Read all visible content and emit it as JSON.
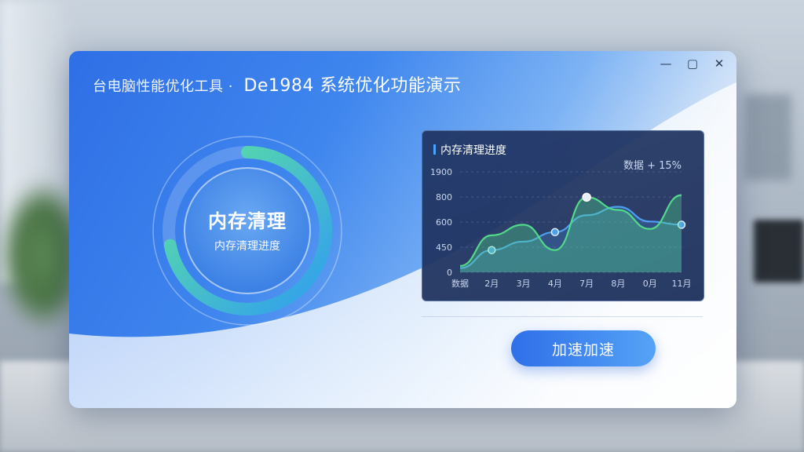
{
  "window": {
    "title_prefix": "台电脑性能优化工具 ·",
    "title": "De1984 系统优化功能演示",
    "controls": {
      "minimize": "—",
      "maximize": "▢",
      "close": "✕"
    }
  },
  "ring": {
    "title": "内存清理",
    "subtitle": "内存清理进度",
    "progress": 0.72,
    "colors": {
      "start": "#2f9df0",
      "end": "#5fe3a0",
      "track": "rgba(255,255,255,0.18)"
    }
  },
  "chart_data": {
    "type": "line",
    "title": "内存清理进度",
    "annotation": "数据 + 15%",
    "y_ticks": [
      "1900",
      "800",
      "600",
      "450",
      "0"
    ],
    "x_ticks": [
      "数据",
      "2月",
      "3月",
      "4月",
      "7月",
      "8月",
      "0月",
      "11月"
    ],
    "ylim": [
      0,
      1900
    ],
    "series": [
      {
        "color": "#4d9ff0",
        "values": [
          80,
          420,
          580,
          760,
          1080,
          1240,
          960,
          900
        ]
      },
      {
        "color": "#53d98a",
        "values": [
          120,
          700,
          900,
          420,
          1420,
          1180,
          820,
          1460
        ]
      }
    ]
  },
  "action": {
    "accelerate_label": "加速加速"
  }
}
